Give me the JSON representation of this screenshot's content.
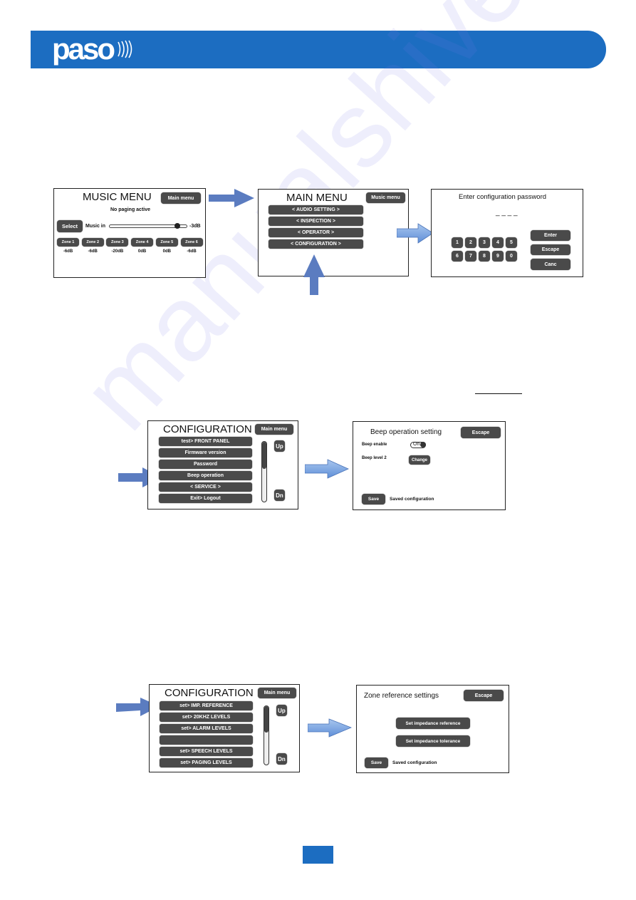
{
  "header": {
    "logo_text": "paso",
    "brand_color": "#1c6dc1"
  },
  "watermark": "manualshive.com",
  "music_menu": {
    "title": "MUSIC MENU",
    "main_menu_button": "Main menu",
    "status": "No paging active",
    "select_button": "Select",
    "music_in_label": "Music in",
    "music_in_value": "-3dB",
    "music_in_level_fraction": 0.9,
    "zones": [
      {
        "label": "Zone 1",
        "level": "-6dB"
      },
      {
        "label": "Zone 2",
        "level": "-6dB"
      },
      {
        "label": "Zone 3",
        "level": "-20dB"
      },
      {
        "label": "Zone 4",
        "level": "0dB"
      },
      {
        "label": "Zone 5",
        "level": "0dB"
      },
      {
        "label": "Zone 6",
        "level": "-6dB"
      }
    ]
  },
  "main_menu": {
    "title": "MAIN MENU",
    "music_menu_button": "Music menu",
    "items": [
      "< AUDIO SETTING >",
      "< INSPECTION >",
      "< OPERATOR >",
      "< CONFIGURATION >"
    ]
  },
  "password": {
    "title": "Enter configuration password",
    "masked": "_ _ _ _",
    "keys_row1": [
      "1",
      "2",
      "3",
      "4",
      "5"
    ],
    "keys_row2": [
      "6",
      "7",
      "8",
      "9",
      "0"
    ],
    "enter_button": "Enter",
    "escape_button": "Escape",
    "canc_button": "Canc"
  },
  "configuration_1": {
    "title": "CONFIGURATION",
    "main_menu_button": "Main menu",
    "items": [
      "test>  FRONT PANEL",
      "Firmware version",
      "Password",
      "Beep operation",
      "< SERVICE >",
      "Exit> Logout"
    ],
    "up_button": "Up",
    "down_button": "Dn"
  },
  "beep_setting": {
    "title": "Beep operation setting",
    "escape_button": "Escape",
    "beep_enable_label": "Beep enable",
    "beep_enable_toggle": "On",
    "beep_level_label": "Beep level 2",
    "change_button": "Change",
    "save_button": "Save",
    "status": "Saved configuration"
  },
  "configuration_2": {
    "title": "CONFIGURATION",
    "main_menu_button": "Main menu",
    "items": [
      "set>  IMP. REFERENCE",
      "set>  20KHZ LEVELS",
      "set>  ALARM LEVELS",
      "",
      "set>  SPEECH LEVELS",
      "set>  PAGING LEVELS"
    ],
    "up_button": "Up",
    "down_button": "Dn"
  },
  "zone_reference": {
    "title": "Zone reference settings",
    "escape_button": "Escape",
    "set_reference_button": "Set impedance reference",
    "set_tolerance_button": "Set impedance tolerance",
    "save_button": "Save",
    "status": "Saved configuration"
  }
}
